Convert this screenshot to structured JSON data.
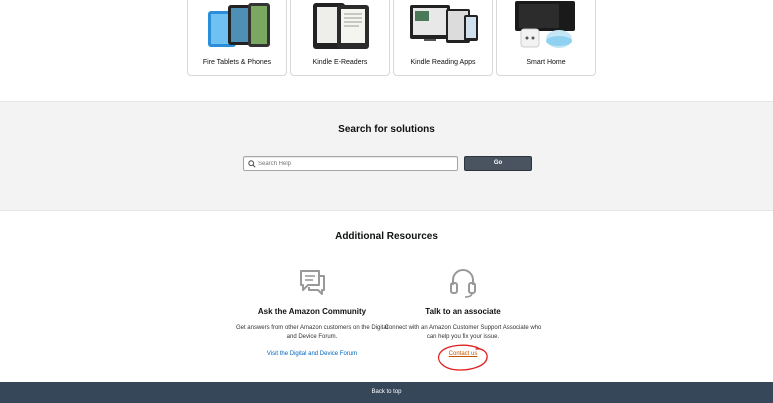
{
  "tiles": [
    {
      "label": "Fire Tablets & Phones",
      "icon": "fire-tablets-image"
    },
    {
      "label": "Kindle E-Readers",
      "icon": "kindle-ereader-image"
    },
    {
      "label": "Kindle Reading Apps",
      "icon": "kindle-apps-image"
    },
    {
      "label": "Smart Home",
      "icon": "smart-home-image"
    }
  ],
  "search": {
    "title": "Search for solutions",
    "placeholder": "Search Help",
    "go_label": "Go"
  },
  "resources": {
    "title": "Additional Resources",
    "community": {
      "heading": "Ask the Amazon Community",
      "description": "Get answers from other Amazon customers on the Digital and Device Forum.",
      "link": "Visit the Digital and Device Forum",
      "icon": "chat-bubbles-icon"
    },
    "associate": {
      "heading": "Talk to an associate",
      "description": "Connect with an Amazon Customer Support Associate who can help you fix your issue.",
      "link": "Contact us",
      "icon": "headset-icon"
    }
  },
  "annotation": {
    "color": "#e02020"
  },
  "footer": {
    "back_to_top": "Back to top"
  }
}
